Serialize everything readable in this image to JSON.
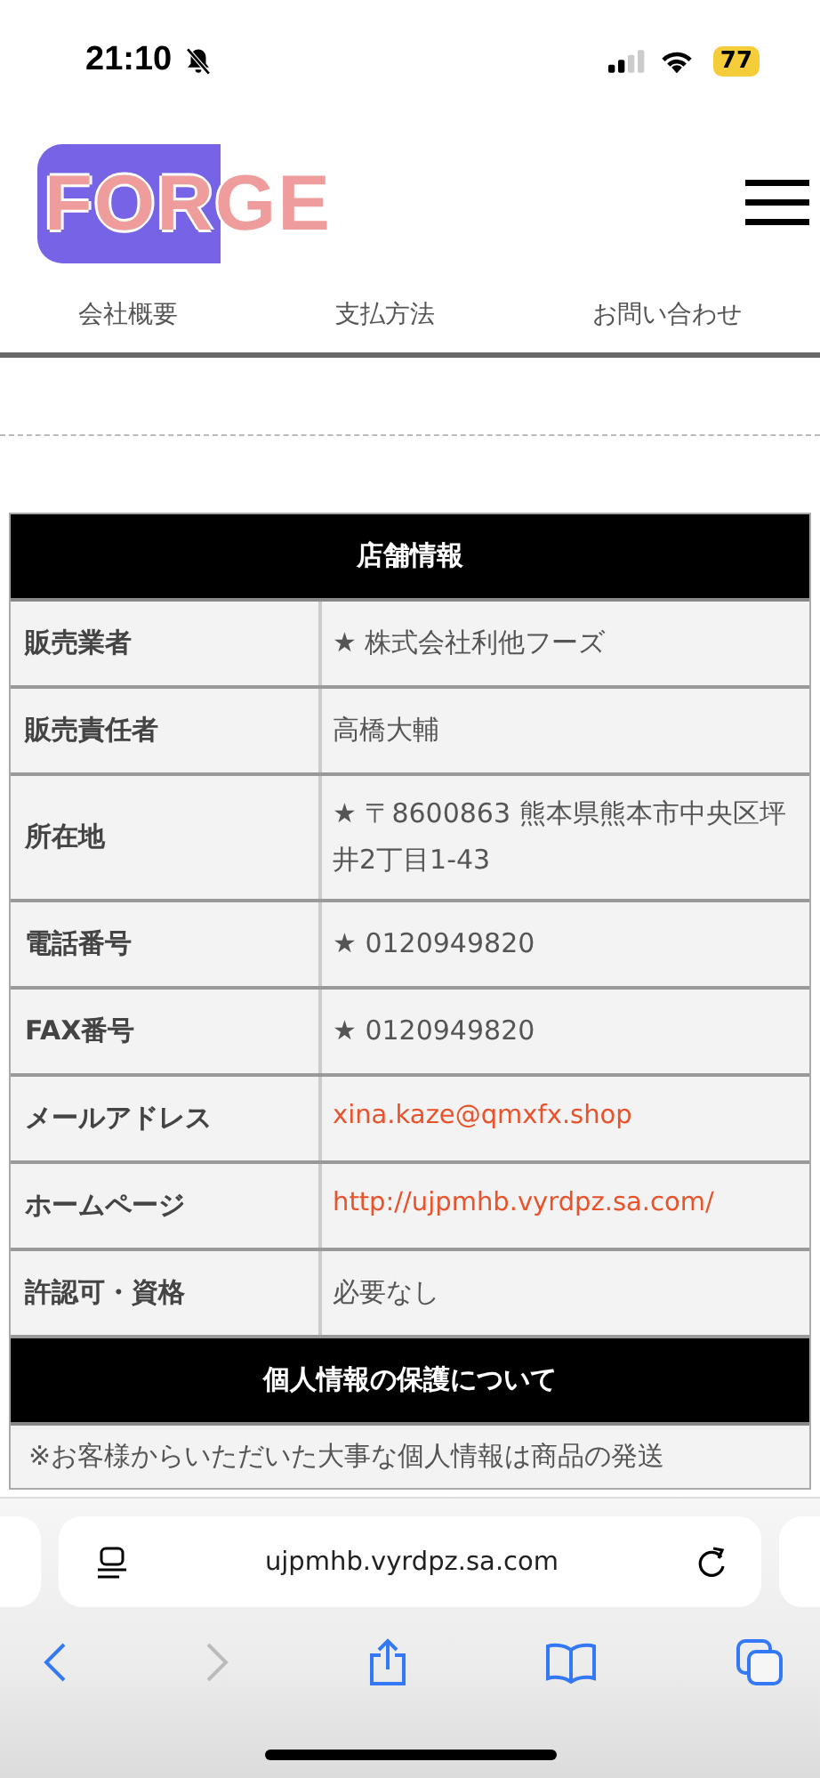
{
  "status_bar": {
    "time": "21:10",
    "battery": "77"
  },
  "logo": "FORGE",
  "nav": [
    {
      "label": "会社概要"
    },
    {
      "label": "支払方法"
    },
    {
      "label": "お問い合わせ"
    }
  ],
  "store_table": {
    "title": "店舗情報",
    "rows": [
      {
        "label": "販売業者",
        "value": "★ 株式会社利他フーズ",
        "kind": "text"
      },
      {
        "label": "販売責任者",
        "value": "高橋大輔",
        "kind": "text"
      },
      {
        "label": "所在地",
        "value": "★ 〒8600863 熊本県熊本市中央区坪井2丁目1-43",
        "kind": "text"
      },
      {
        "label": "電話番号",
        "value": "★ 0120949820",
        "kind": "text"
      },
      {
        "label": "FAX番号",
        "value": "★ 0120949820",
        "kind": "text"
      },
      {
        "label": "メールアドレス",
        "value": "xina.kaze@qmxfx.shop",
        "kind": "link"
      },
      {
        "label": "ホームページ",
        "value": "http://ujpmhb.vyrdpz.sa.com/",
        "kind": "link"
      },
      {
        "label": "許認可・資格",
        "value": "必要なし",
        "kind": "text"
      }
    ]
  },
  "privacy": {
    "title": "個人情報の保護について",
    "text": "※お客様からいただいた大事な個人情報は商品の発送"
  },
  "browser": {
    "url": "ujpmhb.vyrdpz.sa.com"
  }
}
